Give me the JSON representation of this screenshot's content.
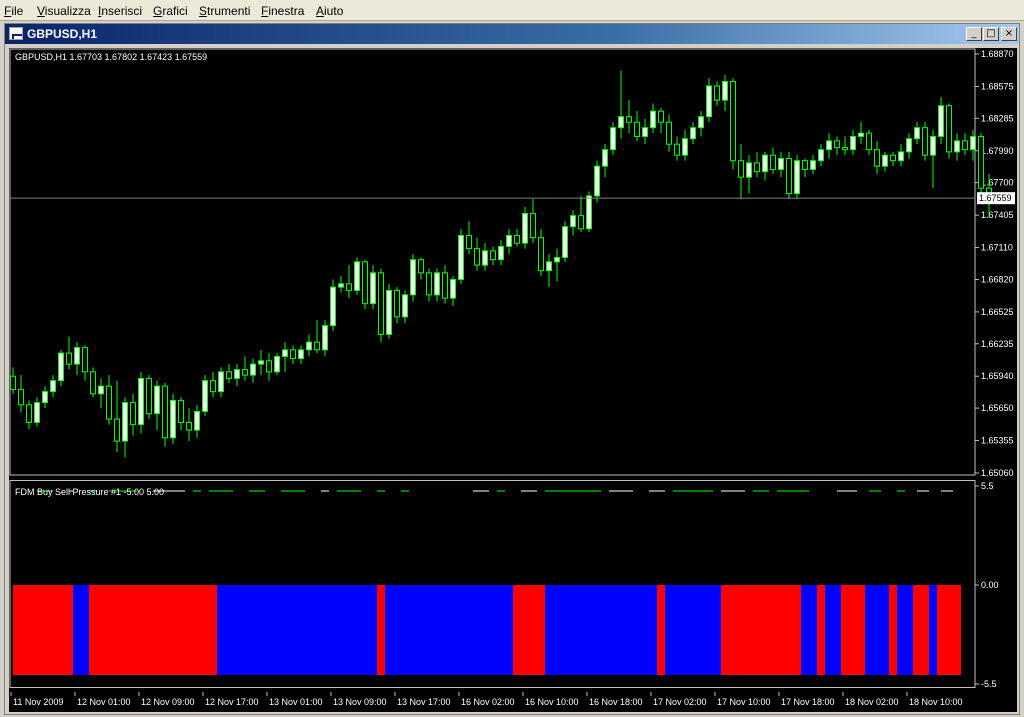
{
  "menu": [
    "File",
    "Visualizza",
    "Inserisci",
    "Grafici",
    "Strumenti",
    "Finestra",
    "Aiuto"
  ],
  "window": {
    "title": "GBPUSD,H1",
    "minimize_glyph": "_",
    "restore_glyph": "□",
    "close_glyph": "×"
  },
  "colors": {
    "bull": "#ffffff",
    "wick": "#00ff00",
    "bear": "#000000",
    "buy_pressure": "#ff0000",
    "sell_pressure": "#0000ff",
    "axis_text": "#ffffff",
    "price_line": "#808080"
  },
  "chart_data": [
    {
      "type": "candlestick",
      "symbol": "GBPUSD,H1",
      "header": "GBPUSD,H1  1.67703 1.67802 1.67423 1.67559",
      "current_price_label": "1.67559",
      "current_price": 1.67559,
      "y_ticks": [
        "1.68870",
        "1.68575",
        "1.68285",
        "1.67990",
        "1.67700",
        "1.67405",
        "1.67110",
        "1.66820",
        "1.66525",
        "1.66235",
        "1.65940",
        "1.65650",
        "1.65355",
        "1.65060"
      ],
      "ylim": [
        1.6506,
        1.6887
      ],
      "candles": [
        [
          1.6594,
          1.6602,
          1.6578,
          1.6582
        ],
        [
          1.6582,
          1.6595,
          1.6561,
          1.6568
        ],
        [
          1.6568,
          1.6572,
          1.6546,
          1.6552
        ],
        [
          1.6552,
          1.6575,
          1.6548,
          1.657
        ],
        [
          1.657,
          1.6585,
          1.6565,
          1.658
        ],
        [
          1.658,
          1.6595,
          1.6575,
          1.659
        ],
        [
          1.659,
          1.6618,
          1.6585,
          1.6615
        ],
        [
          1.6615,
          1.663,
          1.66,
          1.6605
        ],
        [
          1.6605,
          1.6625,
          1.6595,
          1.662
        ],
        [
          1.662,
          1.6622,
          1.659,
          1.6598
        ],
        [
          1.6598,
          1.6602,
          1.6575,
          1.6578
        ],
        [
          1.6578,
          1.6592,
          1.6565,
          1.6585
        ],
        [
          1.6585,
          1.6595,
          1.655,
          1.6555
        ],
        [
          1.6555,
          1.659,
          1.6525,
          1.6535
        ],
        [
          1.6535,
          1.6575,
          1.652,
          1.657
        ],
        [
          1.657,
          1.6578,
          1.654,
          1.655
        ],
        [
          1.655,
          1.6598,
          1.6542,
          1.6592
        ],
        [
          1.6592,
          1.6595,
          1.6555,
          1.656
        ],
        [
          1.656,
          1.659,
          1.6545,
          1.6585
        ],
        [
          1.6585,
          1.6588,
          1.653,
          1.6538
        ],
        [
          1.6538,
          1.6578,
          1.6532,
          1.6572
        ],
        [
          1.6572,
          1.6575,
          1.6545,
          1.6552
        ],
        [
          1.6552,
          1.6565,
          1.6535,
          1.6545
        ],
        [
          1.6545,
          1.6568,
          1.6538,
          1.6562
        ],
        [
          1.6562,
          1.6595,
          1.6558,
          1.659
        ],
        [
          1.659,
          1.6598,
          1.6575,
          1.658
        ],
        [
          1.658,
          1.6602,
          1.6575,
          1.6598
        ],
        [
          1.6598,
          1.6605,
          1.6588,
          1.6592
        ],
        [
          1.6592,
          1.6605,
          1.6585,
          1.66
        ],
        [
          1.66,
          1.6612,
          1.659,
          1.6595
        ],
        [
          1.6595,
          1.661,
          1.6588,
          1.6605
        ],
        [
          1.6605,
          1.6618,
          1.6595,
          1.6608
        ],
        [
          1.6608,
          1.6615,
          1.659,
          1.6598
        ],
        [
          1.6598,
          1.6615,
          1.6595,
          1.6612
        ],
        [
          1.6612,
          1.6625,
          1.6598,
          1.6618
        ],
        [
          1.6618,
          1.6622,
          1.6605,
          1.661
        ],
        [
          1.661,
          1.6622,
          1.6605,
          1.6618
        ],
        [
          1.6618,
          1.6632,
          1.6612,
          1.6625
        ],
        [
          1.6625,
          1.6645,
          1.6615,
          1.6618
        ],
        [
          1.6618,
          1.6645,
          1.6612,
          1.664
        ],
        [
          1.664,
          1.6682,
          1.6635,
          1.6675
        ],
        [
          1.6675,
          1.6685,
          1.667,
          1.6678
        ],
        [
          1.6678,
          1.6695,
          1.6665,
          1.6672
        ],
        [
          1.6672,
          1.6702,
          1.6668,
          1.6698
        ],
        [
          1.6698,
          1.67,
          1.6655,
          1.666
        ],
        [
          1.666,
          1.6695,
          1.6655,
          1.6688
        ],
        [
          1.6688,
          1.6692,
          1.6625,
          1.6632
        ],
        [
          1.6632,
          1.6678,
          1.6628,
          1.6672
        ],
        [
          1.6672,
          1.6675,
          1.6642,
          1.6648
        ],
        [
          1.6648,
          1.6672,
          1.6642,
          1.6668
        ],
        [
          1.6668,
          1.6705,
          1.6662,
          1.67
        ],
        [
          1.67,
          1.6702,
          1.6682,
          1.6688
        ],
        [
          1.6688,
          1.6692,
          1.6662,
          1.6668
        ],
        [
          1.6668,
          1.6692,
          1.6662,
          1.6688
        ],
        [
          1.6688,
          1.6695,
          1.666,
          1.6665
        ],
        [
          1.6665,
          1.6685,
          1.6658,
          1.6682
        ],
        [
          1.6682,
          1.6728,
          1.6678,
          1.6722
        ],
        [
          1.6722,
          1.6735,
          1.6705,
          1.671
        ],
        [
          1.671,
          1.672,
          1.669,
          1.6695
        ],
        [
          1.6695,
          1.6715,
          1.669,
          1.6708
        ],
        [
          1.6708,
          1.6712,
          1.6695,
          1.67
        ],
        [
          1.67,
          1.6718,
          1.6695,
          1.6712
        ],
        [
          1.6712,
          1.6728,
          1.6705,
          1.6722
        ],
        [
          1.6722,
          1.6728,
          1.6712,
          1.6715
        ],
        [
          1.6715,
          1.6748,
          1.671,
          1.6742
        ],
        [
          1.6742,
          1.6755,
          1.6715,
          1.672
        ],
        [
          1.672,
          1.6728,
          1.6685,
          1.669
        ],
        [
          1.669,
          1.6705,
          1.6675,
          1.6698
        ],
        [
          1.6698,
          1.671,
          1.668,
          1.6702
        ],
        [
          1.6702,
          1.6735,
          1.6698,
          1.673
        ],
        [
          1.673,
          1.6745,
          1.6722,
          1.674
        ],
        [
          1.674,
          1.6758,
          1.6725,
          1.6728
        ],
        [
          1.6728,
          1.6762,
          1.6725,
          1.6758
        ],
        [
          1.6758,
          1.679,
          1.6752,
          1.6785
        ],
        [
          1.6785,
          1.6805,
          1.6775,
          1.68
        ],
        [
          1.68,
          1.6825,
          1.6795,
          1.682
        ],
        [
          1.682,
          1.6872,
          1.681,
          1.683
        ],
        [
          1.683,
          1.6845,
          1.6815,
          1.6825
        ],
        [
          1.6825,
          1.6835,
          1.6808,
          1.6812
        ],
        [
          1.6812,
          1.6828,
          1.6805,
          1.682
        ],
        [
          1.682,
          1.6842,
          1.6815,
          1.6835
        ],
        [
          1.6835,
          1.6838,
          1.6815,
          1.6825
        ],
        [
          1.6825,
          1.6832,
          1.6798,
          1.6805
        ],
        [
          1.6805,
          1.6812,
          1.679,
          1.6795
        ],
        [
          1.6795,
          1.6818,
          1.679,
          1.681
        ],
        [
          1.681,
          1.6825,
          1.6805,
          1.682
        ],
        [
          1.682,
          1.6835,
          1.6812,
          1.683
        ],
        [
          1.683,
          1.6865,
          1.6825,
          1.6858
        ],
        [
          1.6858,
          1.6862,
          1.684,
          1.6845
        ],
        [
          1.6845,
          1.6868,
          1.6835,
          1.6862
        ],
        [
          1.6862,
          1.6865,
          1.6782,
          1.679
        ],
        [
          1.679,
          1.6805,
          1.6755,
          1.6775
        ],
        [
          1.6775,
          1.6795,
          1.676,
          1.6788
        ],
        [
          1.6788,
          1.6798,
          1.6775,
          1.678
        ],
        [
          1.678,
          1.6798,
          1.6772,
          1.6795
        ],
        [
          1.6795,
          1.6802,
          1.6778,
          1.6782
        ],
        [
          1.6782,
          1.6798,
          1.6775,
          1.6792
        ],
        [
          1.6792,
          1.6798,
          1.6755,
          1.676
        ],
        [
          1.676,
          1.6795,
          1.6755,
          1.679
        ],
        [
          1.679,
          1.6792,
          1.6775,
          1.6782
        ],
        [
          1.6782,
          1.6795,
          1.6778,
          1.679
        ],
        [
          1.679,
          1.6805,
          1.6785,
          1.68
        ],
        [
          1.68,
          1.6815,
          1.6792,
          1.6808
        ],
        [
          1.6808,
          1.6812,
          1.6795,
          1.6802
        ],
        [
          1.6802,
          1.6812,
          1.6795,
          1.68
        ],
        [
          1.68,
          1.6818,
          1.6795,
          1.6812
        ],
        [
          1.6812,
          1.6825,
          1.6805,
          1.6815
        ],
        [
          1.6815,
          1.6818,
          1.6795,
          1.68
        ],
        [
          1.68,
          1.6808,
          1.6778,
          1.6785
        ],
        [
          1.6785,
          1.6798,
          1.678,
          1.6795
        ],
        [
          1.6795,
          1.6798,
          1.6785,
          1.679
        ],
        [
          1.679,
          1.6805,
          1.6785,
          1.6798
        ],
        [
          1.6798,
          1.6815,
          1.6792,
          1.681
        ],
        [
          1.681,
          1.6825,
          1.6805,
          1.682
        ],
        [
          1.682,
          1.6825,
          1.679,
          1.6795
        ],
        [
          1.6795,
          1.6818,
          1.6765,
          1.6812
        ],
        [
          1.6812,
          1.6848,
          1.6805,
          1.684
        ],
        [
          1.684,
          1.6842,
          1.6792,
          1.6798
        ],
        [
          1.6798,
          1.6815,
          1.679,
          1.6808
        ],
        [
          1.6808,
          1.6815,
          1.6795,
          1.68
        ],
        [
          1.68,
          1.6818,
          1.679,
          1.6812
        ],
        [
          1.6812,
          1.6815,
          1.6758,
          1.6765
        ],
        [
          1.6765,
          1.6778,
          1.6738,
          1.6755
        ]
      ]
    },
    {
      "type": "bar",
      "title": "FDM Buy Sell Pressure #1 -5.00 5.00",
      "y_ticks": [
        "5.5",
        "0.00",
        "-5.5"
      ],
      "ylim": [
        -5.5,
        5.5
      ],
      "segments": [
        {
          "sign": "buy",
          "from": 0,
          "to": 7.5
        },
        {
          "sign": "sell",
          "from": 7.5,
          "to": 9.5
        },
        {
          "sign": "buy",
          "from": 9.5,
          "to": 25.5
        },
        {
          "sign": "sell",
          "from": 25.5,
          "to": 45.5
        },
        {
          "sign": "buy",
          "from": 45.5,
          "to": 46.5
        },
        {
          "sign": "sell",
          "from": 46.5,
          "to": 62.5
        },
        {
          "sign": "buy",
          "from": 62.5,
          "to": 66.5
        },
        {
          "sign": "sell",
          "from": 66.5,
          "to": 80.5
        },
        {
          "sign": "buy",
          "from": 80.5,
          "to": 81.5
        },
        {
          "sign": "sell",
          "from": 81.5,
          "to": 88.5
        },
        {
          "sign": "buy",
          "from": 88.5,
          "to": 98.5
        },
        {
          "sign": "sell",
          "from": 98.5,
          "to": 100.5
        },
        {
          "sign": "buy",
          "from": 100.5,
          "to": 101.5
        },
        {
          "sign": "sell",
          "from": 101.5,
          "to": 103.5
        },
        {
          "sign": "buy",
          "from": 103.5,
          "to": 106.5
        },
        {
          "sign": "sell",
          "from": 106.5,
          "to": 109.5
        },
        {
          "sign": "buy",
          "from": 109.5,
          "to": 110.5
        },
        {
          "sign": "sell",
          "from": 110.5,
          "to": 112.5
        },
        {
          "sign": "buy",
          "from": 112.5,
          "to": 114.5
        },
        {
          "sign": "sell",
          "from": 114.5,
          "to": 115.5
        },
        {
          "sign": "buy",
          "from": 115.5,
          "to": 118.5
        }
      ],
      "marker_dashes": [
        {
          "from": 3,
          "to": 5,
          "color": "#00ff00"
        },
        {
          "from": 7,
          "to": 7.5,
          "color": "#ffffff"
        },
        {
          "from": 9.5,
          "to": 10.5,
          "color": "#00ff00"
        },
        {
          "from": 12,
          "to": 15.5,
          "color": "#00ff00"
        },
        {
          "from": 17.5,
          "to": 21.5,
          "color": "#ffffff"
        },
        {
          "from": 22.5,
          "to": 23.5,
          "color": "#00ff00"
        },
        {
          "from": 24.5,
          "to": 27.5,
          "color": "#00ff00"
        },
        {
          "from": 29.5,
          "to": 31.5,
          "color": "#00ff00"
        },
        {
          "from": 33.5,
          "to": 36.5,
          "color": "#00ff00"
        },
        {
          "from": 38.5,
          "to": 39.5,
          "color": "#ffffff"
        },
        {
          "from": 40.5,
          "to": 43.5,
          "color": "#00ff00"
        },
        {
          "from": 45.5,
          "to": 46.5,
          "color": "#00ff00"
        },
        {
          "from": 48.5,
          "to": 49.5,
          "color": "#00ff00"
        },
        {
          "from": 57.5,
          "to": 59.5,
          "color": "#ffffff"
        },
        {
          "from": 60.5,
          "to": 61.5,
          "color": "#00ff00"
        },
        {
          "from": 63.5,
          "to": 65.5,
          "color": "#ffffff"
        },
        {
          "from": 66.5,
          "to": 73.5,
          "color": "#00ff00"
        },
        {
          "from": 74.5,
          "to": 77.5,
          "color": "#ffffff"
        },
        {
          "from": 79.5,
          "to": 81.5,
          "color": "#ffffff"
        },
        {
          "from": 82.5,
          "to": 87.5,
          "color": "#00ff00"
        },
        {
          "from": 88.5,
          "to": 91.5,
          "color": "#ffffff"
        },
        {
          "from": 92.5,
          "to": 94.5,
          "color": "#00ff00"
        },
        {
          "from": 95.5,
          "to": 99.5,
          "color": "#00ff00"
        },
        {
          "from": 103,
          "to": 105.5,
          "color": "#ffffff"
        },
        {
          "from": 107,
          "to": 108.5,
          "color": "#00ff00"
        },
        {
          "from": 110.5,
          "to": 111.5,
          "color": "#00ff00"
        },
        {
          "from": 113,
          "to": 114.5,
          "color": "#ffffff"
        },
        {
          "from": 116,
          "to": 117.5,
          "color": "#ffffff"
        }
      ]
    }
  ],
  "time_axis": {
    "labels": [
      "11 Nov 2009",
      "12 Nov 01:00",
      "12 Nov 09:00",
      "12 Nov 17:00",
      "13 Nov 01:00",
      "13 Nov 09:00",
      "13 Nov 17:00",
      "16 Nov 02:00",
      "16 Nov 10:00",
      "16 Nov 18:00",
      "17 Nov 02:00",
      "17 Nov 10:00",
      "17 Nov 18:00",
      "18 Nov 02:00",
      "18 Nov 10:00"
    ],
    "label_bar_index": [
      0,
      8,
      16,
      24,
      32,
      40,
      48,
      56,
      64,
      72,
      80,
      88,
      96,
      104,
      112
    ]
  }
}
